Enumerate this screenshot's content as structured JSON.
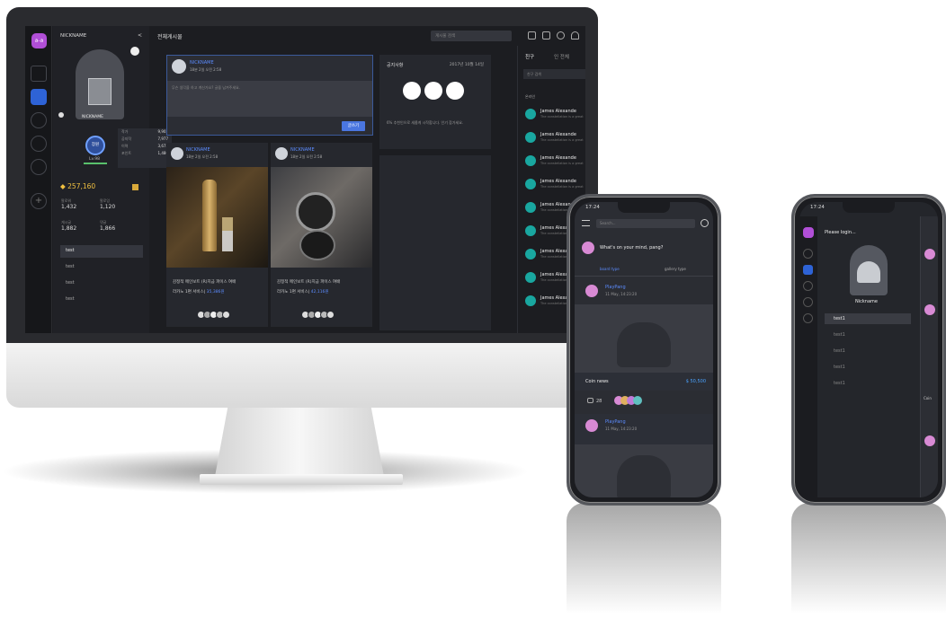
{
  "desktop": {
    "rail_logo": "ล-ล",
    "nickname_top": "NICKNAME",
    "nickname_under": "NICKNAME",
    "level_badge": "장원",
    "level_label": "Lv.98",
    "stats": [
      {
        "k": "작가",
        "v": "9,905"
      },
      {
        "k": "공지작",
        "v": "7,977"
      },
      {
        "k": "이력",
        "v": "3,672"
      },
      {
        "k": "포인트",
        "v": "1,480"
      }
    ],
    "coins": "257,160",
    "kv": [
      {
        "k": "팔로워",
        "v": "1,432"
      },
      {
        "k": "팔로잉",
        "v": "1,120"
      },
      {
        "k": "게시글",
        "v": "1,882"
      },
      {
        "k": "댓글",
        "v": "1,866"
      }
    ],
    "menu": [
      "test",
      "test",
      "test",
      "test"
    ],
    "board_title": "전체게시물",
    "search_placeholder": "게시물 검색",
    "composer": {
      "author": "NICKNAME",
      "time": "18분 2일 오전 2:58",
      "placeholder": "무슨 생각을 하고 계신가요? 글을 남겨주세요.",
      "post_label": "글쓰기"
    },
    "feed": [
      {
        "author": "NICKNAME",
        "time": "18분 2일 오전 2:58",
        "text": "감정적 메인보트 (R)지금 파이스 여배",
        "text2": "라카노 1편 서비스|",
        "amount": "35,386원"
      },
      {
        "author": "NICKNAME",
        "time": "18분 2일 오전 2:58",
        "text": "감정적 메인보트 (R)지금 파이스 여배",
        "text2": "라카노 1편 서비스|",
        "amount": "42,116원"
      }
    ],
    "notice": {
      "title": "공지사항",
      "date": "2017년 10월 14일",
      "body": "6% 추천인으로 새롭게 시작합니다. 인기 참가세요."
    },
    "friends_tab": "친구",
    "friends_tab2": "인 전체",
    "friends_search": "친구 검색",
    "friends_section": "온라인",
    "friends": [
      {
        "name": "James Alexande",
        "sub": "The constellation is a great"
      },
      {
        "name": "James Alexande",
        "sub": "The constellation is a great"
      },
      {
        "name": "James Alexande",
        "sub": "The constellation is a great"
      },
      {
        "name": "James Alexande",
        "sub": "The constellation is a great"
      },
      {
        "name": "James Alexande",
        "sub": "The constellation is a great"
      },
      {
        "name": "James Alexande",
        "sub": "The constellation is a great"
      },
      {
        "name": "James Alexande",
        "sub": "The constellation is a great"
      },
      {
        "name": "James Alexande",
        "sub": "The constellation is a great"
      },
      {
        "name": "James Alexande",
        "sub": "The constellation is a great"
      }
    ]
  },
  "phone1": {
    "time": "17:24",
    "search_placeholder": "Search...",
    "prompt": "What's on your mind, pang?",
    "tab1": "board type",
    "tab2": "gallery type",
    "post1_author": "PlayPang",
    "post1_time": "11 May, 14:23:20",
    "coin_label": "Coin news",
    "coin_value": "$ 50,500",
    "comment_count": "28",
    "post2_author": "PlayPang",
    "post2_time": "11 May, 14:23:20"
  },
  "phone2": {
    "time": "17:24",
    "title": "Please login...",
    "nickname": "Nickname",
    "menu": [
      "test1",
      "test1",
      "test1",
      "test1",
      "test1"
    ],
    "side_label": "Coin"
  }
}
